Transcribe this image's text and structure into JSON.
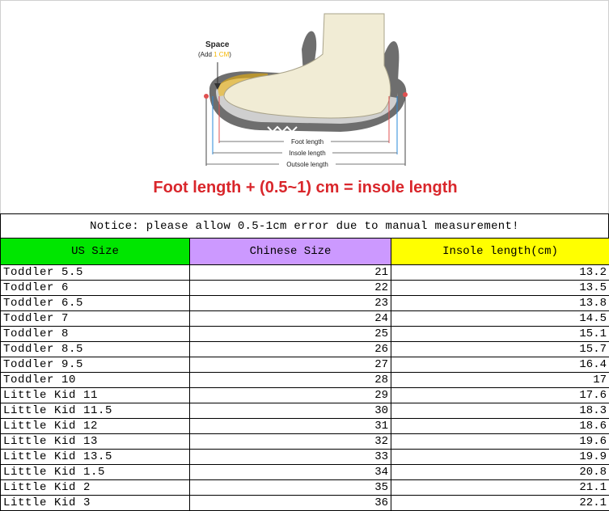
{
  "illustration": {
    "space_label": "Space",
    "space_add_prefix": "(Add ",
    "space_add_value": "1 CM",
    "space_add_suffix": ")",
    "foot_length": "Foot length",
    "insole_length": "Insole length",
    "outsole_length": "Outsole length",
    "formula": "Foot length + (0.5~1) cm = insole length"
  },
  "colors": {
    "formula": "#d9262b",
    "us_header": "#00e600",
    "cn_header": "#cc99ff",
    "insole_header": "#ffff00",
    "space_highlight": "#f5b700"
  },
  "notice": "Notice: please allow 0.5-1cm error due to manual measurement!",
  "table": {
    "headers": [
      "US Size",
      "Chinese Size",
      "Insole length(cm)"
    ],
    "rows": [
      [
        "Toddler 5.5",
        "21",
        "13.2"
      ],
      [
        "Toddler 6",
        "22",
        "13.5"
      ],
      [
        "Toddler 6.5",
        "23",
        "13.8"
      ],
      [
        "Toddler 7",
        "24",
        "14.5"
      ],
      [
        "Toddler 8",
        "25",
        "15.1"
      ],
      [
        "Toddler 8.5",
        "26",
        "15.7"
      ],
      [
        "Toddler 9.5",
        "27",
        "16.4"
      ],
      [
        "Toddler 10",
        "28",
        "17"
      ],
      [
        "Little Kid 11",
        "29",
        "17.6"
      ],
      [
        "Little Kid 11.5",
        "30",
        "18.3"
      ],
      [
        "Little Kid 12",
        "31",
        "18.6"
      ],
      [
        "Little Kid 13",
        "32",
        "19.6"
      ],
      [
        "Little Kid 13.5",
        "33",
        "19.9"
      ],
      [
        "Little Kid 1.5",
        "34",
        "20.8"
      ],
      [
        "Little Kid 2",
        "35",
        "21.1"
      ],
      [
        "Little Kid 3",
        "36",
        "22.1"
      ]
    ]
  }
}
